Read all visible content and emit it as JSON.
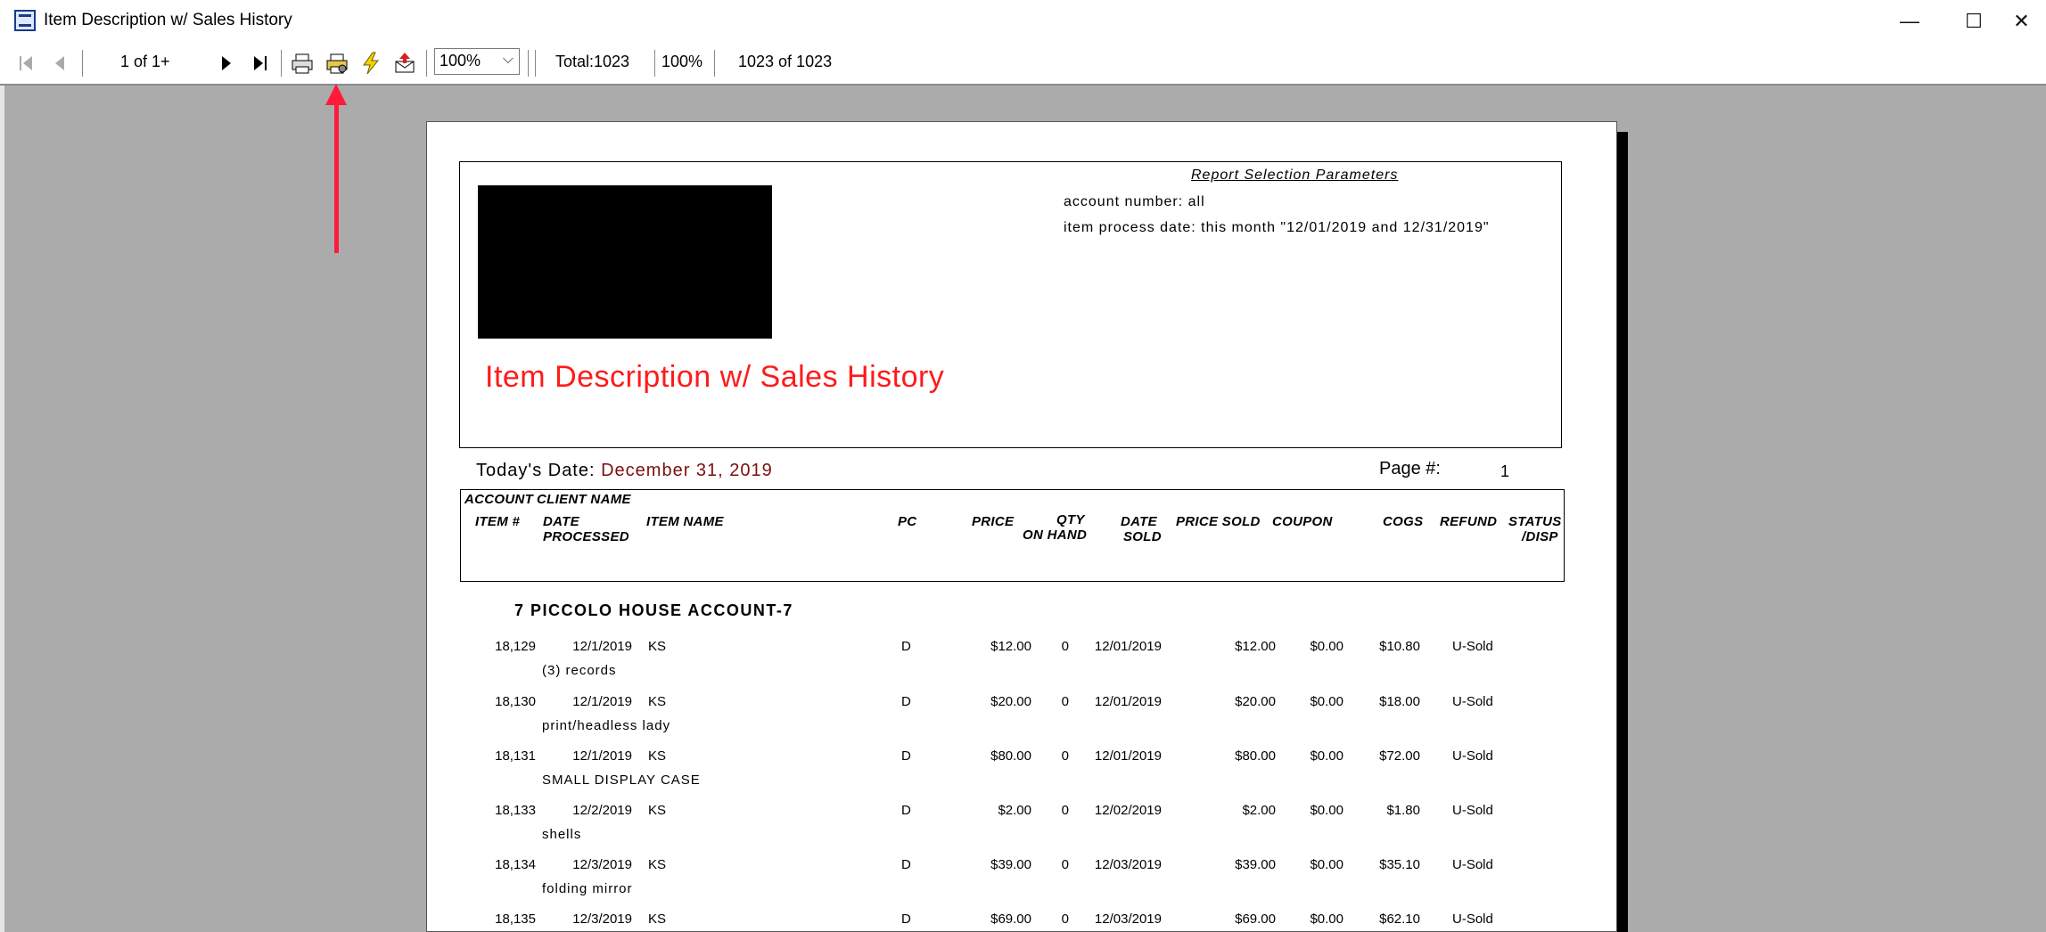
{
  "window": {
    "title": "Item Description w/ Sales History",
    "minimize_glyph": "—",
    "maximize_glyph": "☐",
    "close_glyph": "✕"
  },
  "toolbar": {
    "page_indicator": "1 of 1+",
    "zoom_value": "100%",
    "total": "Total:1023",
    "percent": "100%",
    "record_count": "1023 of 1023",
    "icons": [
      "first-page-icon",
      "previous-page-icon",
      "next-page-icon",
      "last-page-icon",
      "print-icon",
      "print-setup-icon",
      "lightning-icon",
      "export-icon"
    ]
  },
  "annotation": {
    "arrow_color": "#ff1a3c"
  },
  "report": {
    "title": "Item Description w/ Sales History",
    "title_color": "#ff1a1a",
    "params_title": "Report Selection Parameters",
    "param_account": "account number: all",
    "param_date": "item process date: this month \"12/01/2019 and 12/31/2019\"",
    "today_label": "Today's Date:",
    "today_value": "December 31, 2019",
    "page_label": "Page #:",
    "page_value": "1",
    "columns": {
      "account": "ACCOUNT",
      "client_name": "CLIENT NAME",
      "item": "ITEM #",
      "date_processed_1": "DATE",
      "date_processed_2": "PROCESSED",
      "item_name": "ITEM NAME",
      "pc": "PC",
      "price": "PRICE",
      "qty_1": "QTY",
      "qty_2": "ON HAND",
      "date_sold_1": "DATE",
      "date_sold_2": "SOLD",
      "price_sold": "PRICE SOLD",
      "coupon": "COUPON",
      "cogs": "COGS",
      "refund": "REFUND",
      "status_1": "STATUS",
      "status_2": "/DISP"
    },
    "account_header": "7   PICCOLO HOUSE ACCOUNT-7",
    "rows": [
      {
        "item": "18,129",
        "date_processed": "12/1/2019",
        "item_name": "KS",
        "pc": "D",
        "price": "$12.00",
        "qty": "0",
        "date_sold": "12/01/2019",
        "price_sold": "$12.00",
        "coupon": "$0.00",
        "cogs": "$10.80",
        "status": "U-Sold",
        "description": "(3) records"
      },
      {
        "item": "18,130",
        "date_processed": "12/1/2019",
        "item_name": "KS",
        "pc": "D",
        "price": "$20.00",
        "qty": "0",
        "date_sold": "12/01/2019",
        "price_sold": "$20.00",
        "coupon": "$0.00",
        "cogs": "$18.00",
        "status": "U-Sold",
        "description": "print/headless lady"
      },
      {
        "item": "18,131",
        "date_processed": "12/1/2019",
        "item_name": "KS",
        "pc": "D",
        "price": "$80.00",
        "qty": "0",
        "date_sold": "12/01/2019",
        "price_sold": "$80.00",
        "coupon": "$0.00",
        "cogs": "$72.00",
        "status": "U-Sold",
        "description": "SMALL DISPLAY CASE"
      },
      {
        "item": "18,133",
        "date_processed": "12/2/2019",
        "item_name": "KS",
        "pc": "D",
        "price": "$2.00",
        "qty": "0",
        "date_sold": "12/02/2019",
        "price_sold": "$2.00",
        "coupon": "$0.00",
        "cogs": "$1.80",
        "status": "U-Sold",
        "description": "shells"
      },
      {
        "item": "18,134",
        "date_processed": "12/3/2019",
        "item_name": "KS",
        "pc": "D",
        "price": "$39.00",
        "qty": "0",
        "date_sold": "12/03/2019",
        "price_sold": "$39.00",
        "coupon": "$0.00",
        "cogs": "$35.10",
        "status": "U-Sold",
        "description": "folding mirror"
      },
      {
        "item": "18,135",
        "date_processed": "12/3/2019",
        "item_name": "KS",
        "pc": "D",
        "price": "$69.00",
        "qty": "0",
        "date_sold": "12/03/2019",
        "price_sold": "$69.00",
        "coupon": "$0.00",
        "cogs": "$62.10",
        "status": "U-Sold",
        "description": ""
      }
    ]
  }
}
